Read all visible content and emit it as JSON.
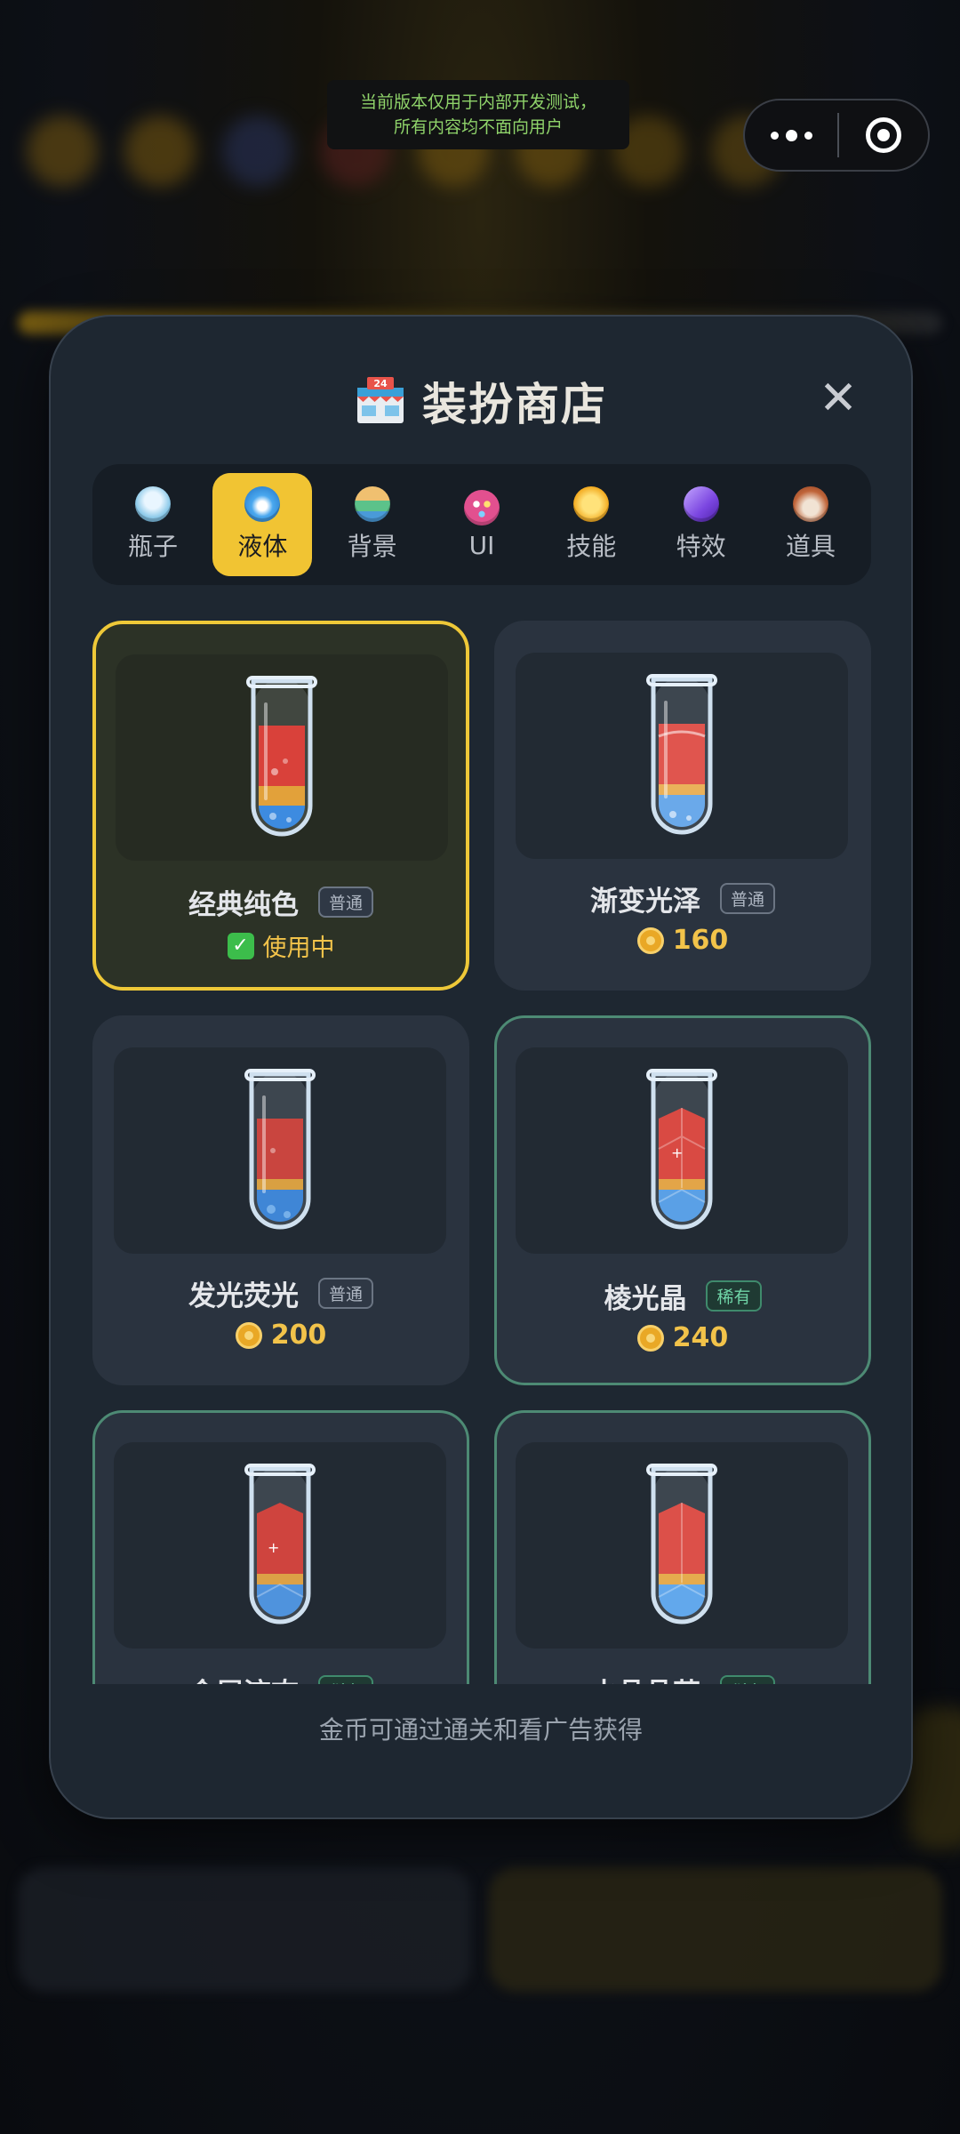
{
  "system": {
    "notice_line1": "当前版本仅用于内部开发测试，",
    "notice_line2": "所有内容均不面向用户"
  },
  "modal": {
    "title": "装扮商店",
    "title_icon": "convenience-store-icon",
    "close_label": "✕",
    "footer": "金币可通过通关和看广告获得"
  },
  "tabs": [
    {
      "label": "瓶子",
      "icon": "bottle-icon",
      "color": "#9fd6f2"
    },
    {
      "label": "液体",
      "icon": "droplet-icon",
      "color": "#3a9be8",
      "active": true
    },
    {
      "label": "背景",
      "icon": "landscape-icon",
      "color": "#f0a35a"
    },
    {
      "label": "UI",
      "icon": "palette-icon",
      "color": "#e9579b"
    },
    {
      "label": "技能",
      "icon": "lightning-icon",
      "color": "#f4b829"
    },
    {
      "label": "特效",
      "icon": "magic-wand-icon",
      "color": "#8b5cf6"
    },
    {
      "label": "道具",
      "icon": "toolbox-icon",
      "color": "#c46a3e"
    }
  ],
  "items": [
    {
      "name": "经典纯色",
      "rarity": "普通",
      "status": "使用中",
      "status_icon": "check-icon"
    },
    {
      "name": "渐变光泽",
      "rarity": "普通",
      "price": "160"
    },
    {
      "name": "发光荧光",
      "rarity": "普通",
      "price": "200"
    },
    {
      "name": "棱光晶",
      "rarity": "稀有",
      "price": "240"
    },
    {
      "name": "金属流态",
      "rarity": "稀有"
    },
    {
      "name": "水晶晶莹",
      "rarity": "稀有"
    }
  ],
  "colors": {
    "accent": "#f1c433",
    "modal_bg": "#1e2731",
    "price": "#f2c34a",
    "rare_border": "#4d8a74",
    "liquid_red": "#d9413a",
    "liquid_yellow": "#e2a13a",
    "liquid_blue": "#3d8be0"
  }
}
